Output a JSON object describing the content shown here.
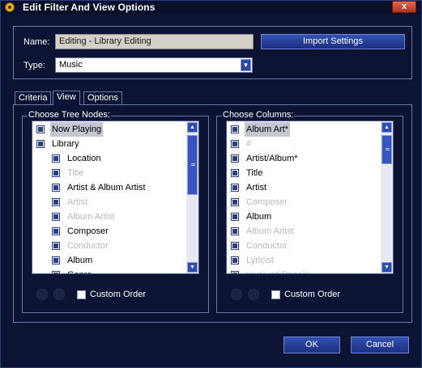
{
  "window": {
    "title": "Edit Filter And View Options",
    "close_label": "x"
  },
  "name_field": {
    "label": "Name:",
    "value": "Editing - Library Editing"
  },
  "type_field": {
    "label": "Type:",
    "value": "Music"
  },
  "import_button": "Import Settings",
  "tabs": [
    {
      "label": "Criteria",
      "active": false
    },
    {
      "label": "View",
      "active": true
    },
    {
      "label": "Options",
      "active": false
    }
  ],
  "tree_nodes": {
    "legend": "Choose Tree Nodes:",
    "items": [
      {
        "label": "Now Playing",
        "checked": true,
        "enabled": true,
        "selected": true
      },
      {
        "label": "Library",
        "checked": true,
        "enabled": true
      },
      {
        "label": "Location",
        "checked": true,
        "enabled": true
      },
      {
        "label": "Title",
        "checked": true,
        "enabled": false
      },
      {
        "label": "Artist & Album Artist",
        "checked": true,
        "enabled": true
      },
      {
        "label": "Artist",
        "checked": true,
        "enabled": false
      },
      {
        "label": "Album Artist",
        "checked": true,
        "enabled": false
      },
      {
        "label": "Composer",
        "checked": true,
        "enabled": true
      },
      {
        "label": "Conductor",
        "checked": true,
        "enabled": false
      },
      {
        "label": "Album",
        "checked": true,
        "enabled": true
      },
      {
        "label": "Genre",
        "checked": true,
        "enabled": true
      }
    ],
    "custom_order_label": "Custom Order",
    "custom_order_checked": false
  },
  "columns": {
    "legend": "Choose Columns:",
    "items": [
      {
        "label": "Album Art*",
        "checked": true,
        "enabled": true,
        "selected": true
      },
      {
        "label": "#",
        "checked": true,
        "enabled": false
      },
      {
        "label": "Artist/Album*",
        "checked": true,
        "enabled": true
      },
      {
        "label": "Title",
        "checked": true,
        "enabled": true
      },
      {
        "label": "Artist",
        "checked": true,
        "enabled": true
      },
      {
        "label": "Composer",
        "checked": true,
        "enabled": false
      },
      {
        "label": "Album",
        "checked": true,
        "enabled": true
      },
      {
        "label": "Album Artist",
        "checked": true,
        "enabled": false
      },
      {
        "label": "Conductor",
        "checked": true,
        "enabled": false
      },
      {
        "label": "Lyricist",
        "checked": true,
        "enabled": false
      },
      {
        "label": "Involved People",
        "checked": true,
        "enabled": false
      }
    ],
    "custom_order_label": "Custom Order",
    "custom_order_checked": false
  },
  "buttons": {
    "ok": "OK",
    "cancel": "Cancel"
  },
  "icons": {
    "app": "app-logo-icon",
    "move_up": "arrow-up-icon",
    "move_down": "arrow-down-icon"
  }
}
